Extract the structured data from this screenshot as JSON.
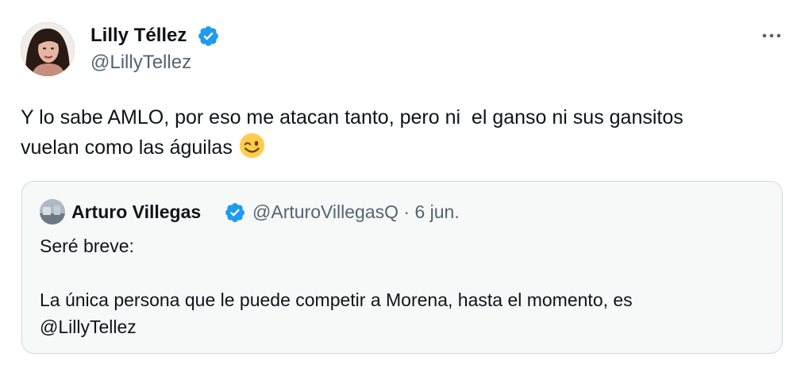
{
  "tweet": {
    "author": {
      "name": "Lilly Téllez",
      "handle": "@LillyTellez",
      "verified": true
    },
    "more_icon": "more-horizontal-icon",
    "text": "Y lo sabe AMLO, por eso me atacan tanto, pero ni  el ganso ni sus gansitos\nvuelan como las águilas",
    "emoji": "winking-face-emoji"
  },
  "quoted_tweet": {
    "author": {
      "name": "Arturo Villegas",
      "handle": "@ArturoVillegasQ",
      "verified": true
    },
    "meta": "@ArturoVillegasQ · 6 jun.",
    "text": "Seré breve:\n\nLa única persona que le puede competir a Morena, hasta el momento, es\n@LillyTellez"
  },
  "colors": {
    "verified_badge": "#1d9bf0",
    "secondary_text": "#536471",
    "card_border": "#cfd9de",
    "card_background": "#f7f9f9"
  }
}
